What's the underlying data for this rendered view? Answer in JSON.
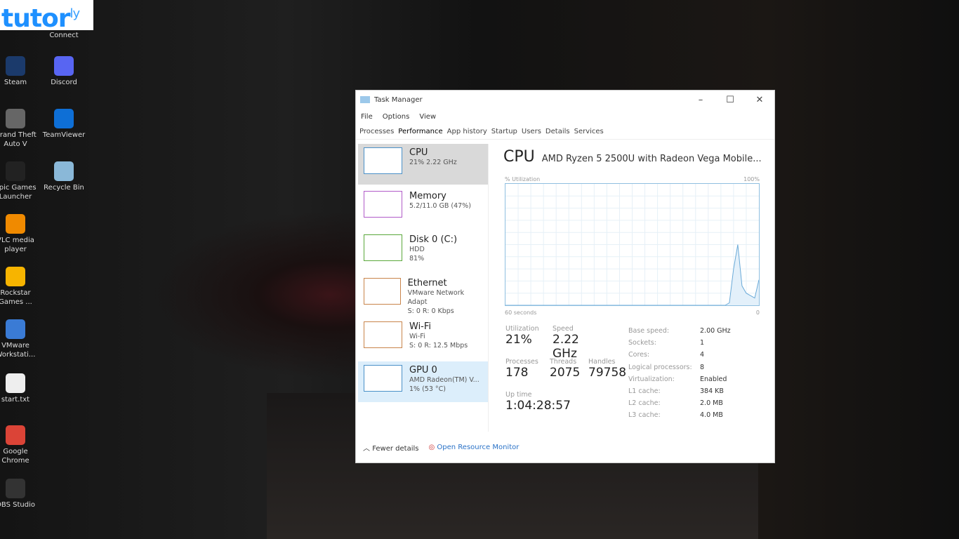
{
  "logo": {
    "text": "tutor",
    "sup": "ly"
  },
  "desktop": {
    "icons": [
      {
        "label": "Steam",
        "color": "#1b3a6b"
      },
      {
        "label": "Discord",
        "color": "#5865f2"
      },
      {
        "label": "Grand Theft Auto V",
        "color": "#666"
      },
      {
        "label": "TeamViewer",
        "color": "#0e6fd6"
      },
      {
        "label": "Epic Games Launcher",
        "color": "#222"
      },
      {
        "label": "Recycle Bin",
        "color": "#8ab8d8"
      },
      {
        "label": "VLC media player",
        "color": "#f08a00"
      },
      {
        "label": "Rockstar Games ...",
        "color": "#f7b400"
      },
      {
        "label": "VMware Workstati...",
        "color": "#3a7bd5"
      },
      {
        "label": "start.txt",
        "color": "#eee"
      },
      {
        "label": "Google Chrome",
        "color": "#db4437"
      },
      {
        "label": "OBS Studio",
        "color": "#333"
      }
    ],
    "partial_top": "Connect"
  },
  "window": {
    "title": "Task Manager",
    "menu": [
      "File",
      "Options",
      "View"
    ],
    "tabs": [
      "Processes",
      "Performance",
      "App history",
      "Startup",
      "Users",
      "Details",
      "Services"
    ],
    "resources": [
      {
        "name": "CPU",
        "l1": "21% 2.22 GHz",
        "l2": "",
        "color": "#4a90c8"
      },
      {
        "name": "Memory",
        "l1": "5.2/11.0 GB (47%)",
        "l2": "",
        "color": "#b15bc8"
      },
      {
        "name": "Disk 0 (C:)",
        "l1": "HDD",
        "l2": "81%",
        "color": "#5aa83a"
      },
      {
        "name": "Ethernet",
        "l1": "VMware Network Adapt",
        "l2": "S: 0 R: 0 Kbps",
        "color": "#c8844a"
      },
      {
        "name": "Wi-Fi",
        "l1": "Wi-Fi",
        "l2": "S: 0 R: 12.5 Mbps",
        "color": "#c8844a"
      },
      {
        "name": "GPU 0",
        "l1": "AMD Radeon(TM) V...",
        "l2": "1% (53 °C)",
        "color": "#4a90c8"
      }
    ],
    "detail": {
      "title": "CPU",
      "model": "AMD Ryzen 5 2500U with Radeon Vega Mobile...",
      "graph_label": "% Utilization",
      "graph_max": "100%",
      "graph_time": "60 seconds",
      "graph_min": "0",
      "utilization_series": [
        0,
        0,
        0,
        0,
        0,
        0,
        0,
        0,
        0,
        0,
        0,
        0,
        0,
        0,
        0,
        0,
        0,
        0,
        0,
        0,
        0,
        0,
        0,
        0,
        0,
        0,
        0,
        0,
        0,
        0,
        0,
        0,
        0,
        0,
        0,
        0,
        0,
        0,
        0,
        0,
        0,
        0,
        0,
        0,
        0,
        0,
        0,
        0,
        0,
        0,
        0,
        0,
        0,
        2,
        30,
        50,
        16,
        10,
        8,
        6,
        21
      ],
      "stats": {
        "utilization_l": "Utilization",
        "utilization": "21%",
        "speed_l": "Speed",
        "speed": "2.22 GHz",
        "processes_l": "Processes",
        "processes": "178",
        "threads_l": "Threads",
        "threads": "2075",
        "handles_l": "Handles",
        "handles": "79758",
        "uptime_l": "Up time",
        "uptime": "1:04:28:57"
      },
      "specs": [
        [
          "Base speed:",
          "2.00 GHz"
        ],
        [
          "Sockets:",
          "1"
        ],
        [
          "Cores:",
          "4"
        ],
        [
          "Logical processors:",
          "8"
        ],
        [
          "Virtualization:",
          "Enabled"
        ],
        [
          "L1 cache:",
          "384 KB"
        ],
        [
          "L2 cache:",
          "2.0 MB"
        ],
        [
          "L3 cache:",
          "4.0 MB"
        ]
      ]
    },
    "footer": {
      "fewer": "Fewer details",
      "monitor": "Open Resource Monitor"
    }
  }
}
